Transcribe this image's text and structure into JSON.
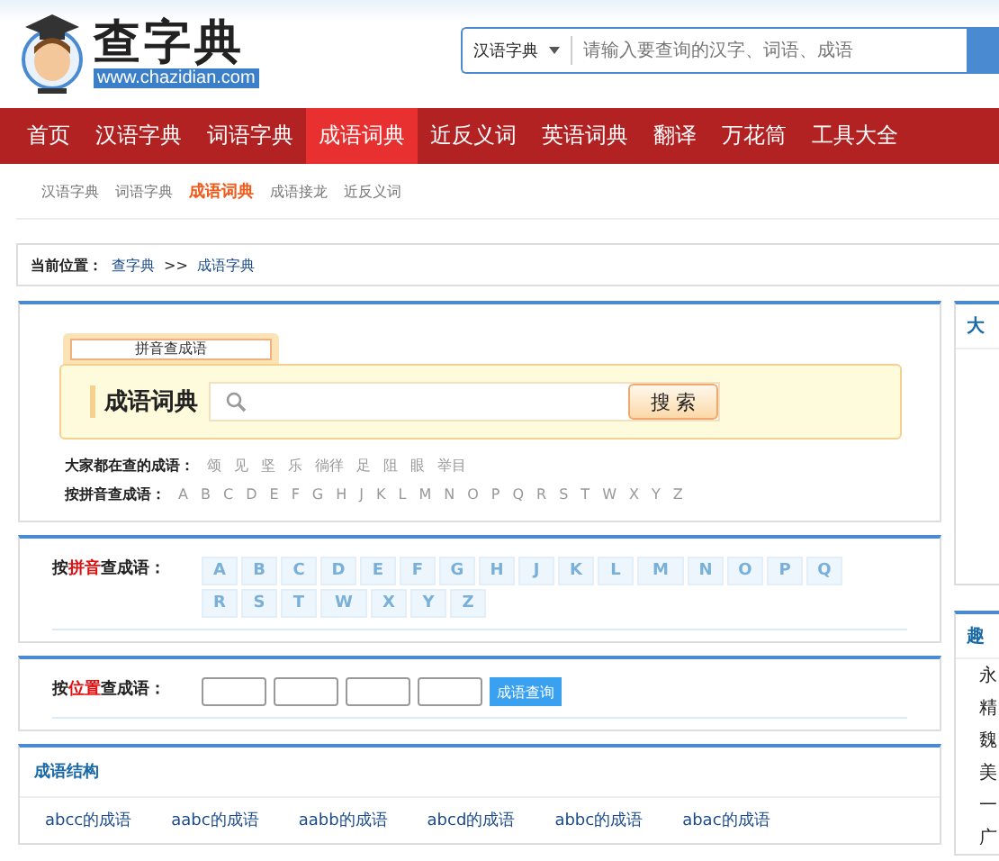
{
  "header": {
    "logo_text": "查字典",
    "logo_url": "www.chazidian.com",
    "search": {
      "dictionary": "汉语字典",
      "placeholder": "请输入要查询的汉字、词语、成语"
    }
  },
  "nav": [
    {
      "label": "首页",
      "selected": false
    },
    {
      "label": "汉语字典",
      "selected": false
    },
    {
      "label": "词语字典",
      "selected": false
    },
    {
      "label": "成语词典",
      "selected": true
    },
    {
      "label": "近反义词",
      "selected": false
    },
    {
      "label": "英语词典",
      "selected": false
    },
    {
      "label": "翻译",
      "selected": false
    },
    {
      "label": "万花筒",
      "selected": false
    },
    {
      "label": "工具大全",
      "selected": false
    }
  ],
  "subnav": [
    {
      "label": "汉语字典",
      "selected": false
    },
    {
      "label": "词语字典",
      "selected": false
    },
    {
      "label": "成语词典",
      "selected": true
    },
    {
      "label": "成语接龙",
      "selected": false
    },
    {
      "label": "近反义词",
      "selected": false
    }
  ],
  "breadcrumb": {
    "label": "当前位置：",
    "links": [
      "查字典",
      "成语字典"
    ],
    "separator": ">>"
  },
  "search_panel": {
    "tab": "拼音查成语",
    "title": "成语词典",
    "button": "搜 索",
    "popular_label": "大家都在查的成语：",
    "popular": [
      "颂",
      "见",
      "坚",
      "乐",
      "徜徉",
      "足",
      "阻",
      "眼",
      "举目"
    ],
    "pinyin_label": "按拼音查成语：",
    "letters": [
      "A",
      "B",
      "C",
      "D",
      "E",
      "F",
      "G",
      "H",
      "J",
      "K",
      "L",
      "M",
      "N",
      "O",
      "P",
      "Q",
      "R",
      "S",
      "T",
      "W",
      "X",
      "Y",
      "Z"
    ]
  },
  "pinyin_panel": {
    "label": [
      {
        "text": "按",
        "highlight": false
      },
      {
        "text": "拼音",
        "highlight": true
      },
      {
        "text": "查成语：",
        "highlight": false
      }
    ],
    "letters": [
      "A",
      "B",
      "C",
      "D",
      "E",
      "F",
      "G",
      "H",
      "J",
      "K",
      "L",
      "M",
      "N",
      "O",
      "P",
      "Q",
      "R",
      "S",
      "T",
      "W",
      "X",
      "Y",
      "Z"
    ]
  },
  "position_panel": {
    "label": [
      {
        "text": "按",
        "highlight": false
      },
      {
        "text": "位置",
        "highlight": true
      },
      {
        "text": "查成语：",
        "highlight": false
      }
    ],
    "button": "成语查询"
  },
  "structure_panel": {
    "title": "成语结构",
    "items": [
      "abcc的成语",
      "aabc的成语",
      "aabb的成语",
      "abcd的成语",
      "abbc的成语",
      "abac的成语"
    ]
  },
  "sidebar": [
    {
      "title": "大"
    },
    {
      "title": "趣",
      "items": [
        "永",
        "精",
        "魏",
        "美",
        "一",
        "广"
      ]
    }
  ]
}
